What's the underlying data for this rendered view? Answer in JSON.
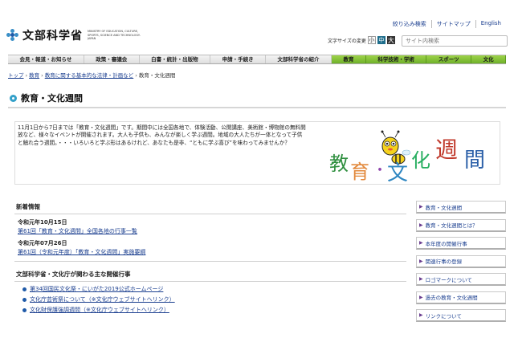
{
  "header": {
    "site_name": "文部科学省",
    "site_name_en": "MINISTRY OF EDUCATION, CULTURE, SPORTS, SCIENCE AND TECHNOLOGY-JAPAN",
    "util_links": [
      "絞り込み検索",
      "サイトマップ",
      "English"
    ],
    "font_size_label": "文字サイズの変更",
    "font_size_buttons": [
      "小",
      "中",
      "大"
    ],
    "search_placeholder": "サイト内検索"
  },
  "nav": [
    "会見・報道・お知らせ",
    "政策・審議会",
    "白書・統計・出版物",
    "申請・手続き",
    "文部科学省の紹介",
    "教育",
    "科学技術・学術",
    "スポーツ",
    "文化"
  ],
  "breadcrumb": {
    "items": [
      "トップ",
      "教育",
      "教育に関する基本的な法律・計画など"
    ],
    "current": "教育・文化週間"
  },
  "page": {
    "title": "教育・文化週間",
    "intro": "11月1日から7日までは「教育・文化週間」です。期間中には全国各地で、体験活動、公開講座、美術館・博物館の無料開放など、様々なイベントが開催されます。大人も子供も、みんなが楽しく学ぶ週間。地域の大人たちが一体となって子供と触れ合う週間。・・・いろいろと学ぶ形はあるけれど、あなたも是非、“ともに学ぶ喜び”を味わってみませんか？",
    "mascot_text": "教育・文化週間"
  },
  "news": {
    "heading": "新着情報",
    "items": [
      {
        "date": "令和元年10月15日",
        "link": "第61回「教育・文化週間」全国各地の行事一覧"
      },
      {
        "date": "令和元年07月26日",
        "link": "第61回（令和元年度）「教育・文化週間」実施要綱"
      }
    ]
  },
  "events": {
    "heading": "文部科学省・文化庁が関わる主な開催行事",
    "items": [
      "第34回国民文化祭・にいがた2019公式ホームページ",
      "文化庁芸術祭について（※文化庁ウェブサイトへリンク）",
      "文化財保護強調週間（※文化庁ウェブサイトへリンク）"
    ]
  },
  "sidebar": [
    "教育・文化週間",
    "教育・文化週間とは？",
    "本年度の開催行事",
    "関連行事の登録",
    "ロゴマークについて",
    "過去の教育・文化週間",
    "リンクについて"
  ],
  "colors": {
    "accent_blue": "#1a3e8f",
    "nav_active_green": "#6fb02a",
    "title_icon": "#33a0c9"
  }
}
